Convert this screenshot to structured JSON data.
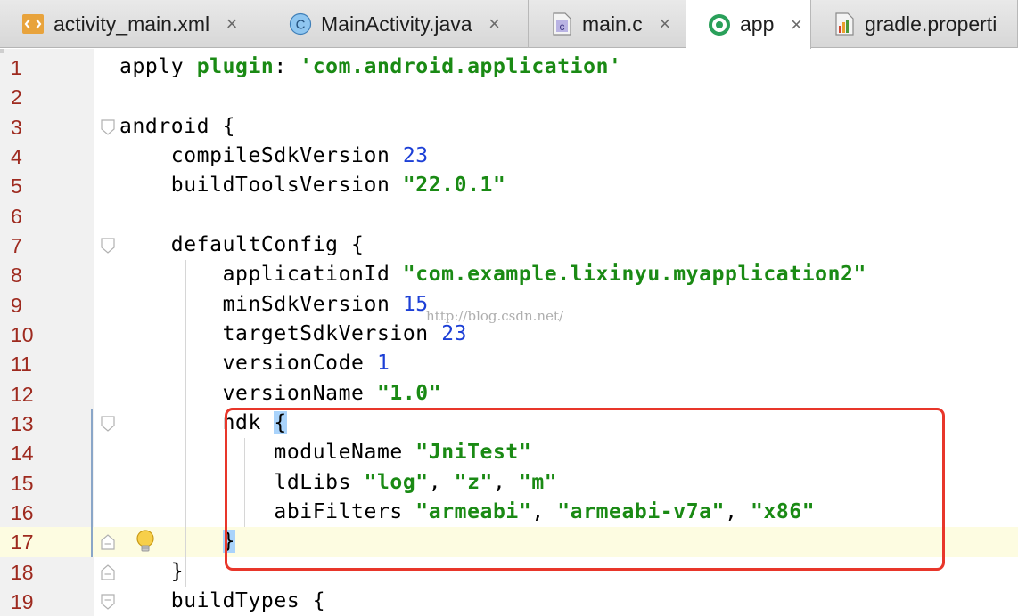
{
  "tabs": [
    {
      "label": "activity_main.xml",
      "icon": "xml-layout-icon",
      "active": false
    },
    {
      "label": "MainActivity.java",
      "icon": "java-class-icon",
      "active": false
    },
    {
      "label": "main.c",
      "icon": "c-file-icon",
      "active": false
    },
    {
      "label": "app",
      "icon": "gradle-module-icon",
      "active": true
    },
    {
      "label": "gradle.properti",
      "icon": "properties-file-icon",
      "active": false
    }
  ],
  "close_glyph": "×",
  "editor": {
    "current_line": 17,
    "lines": [
      {
        "n": "1",
        "tokens": [
          [
            "",
            "apply "
          ],
          [
            "kw",
            "plugin"
          ],
          [
            "",
            ": "
          ],
          [
            "str",
            "'com.android.application'"
          ]
        ]
      },
      {
        "n": "2",
        "tokens": []
      },
      {
        "n": "3",
        "tokens": [
          [
            "",
            "android {"
          ]
        ]
      },
      {
        "n": "4",
        "tokens": [
          [
            "",
            "    compileSdkVersion "
          ],
          [
            "num",
            "23"
          ]
        ]
      },
      {
        "n": "5",
        "tokens": [
          [
            "",
            "    buildToolsVersion "
          ],
          [
            "str",
            "\"22.0.1\""
          ]
        ]
      },
      {
        "n": "6",
        "tokens": []
      },
      {
        "n": "7",
        "tokens": [
          [
            "",
            "    defaultConfig {"
          ]
        ]
      },
      {
        "n": "8",
        "tokens": [
          [
            "",
            "        applicationId "
          ],
          [
            "str",
            "\"com.example.lixinyu.myapplication2\""
          ]
        ]
      },
      {
        "n": "9",
        "tokens": [
          [
            "",
            "        minSdkVersion "
          ],
          [
            "num",
            "15"
          ]
        ]
      },
      {
        "n": "10",
        "tokens": [
          [
            "",
            "        targetSdkVersion "
          ],
          [
            "num",
            "23"
          ]
        ]
      },
      {
        "n": "11",
        "tokens": [
          [
            "",
            "        versionCode "
          ],
          [
            "num",
            "1"
          ]
        ]
      },
      {
        "n": "12",
        "tokens": [
          [
            "",
            "        versionName "
          ],
          [
            "str",
            "\"1.0\""
          ]
        ]
      },
      {
        "n": "13",
        "tokens": [
          [
            "",
            "        ndk "
          ],
          [
            "brace",
            "{"
          ]
        ]
      },
      {
        "n": "14",
        "tokens": [
          [
            "",
            "            moduleName "
          ],
          [
            "str",
            "\"JniTest\""
          ]
        ]
      },
      {
        "n": "15",
        "tokens": [
          [
            "",
            "            ldLibs "
          ],
          [
            "str",
            "\"log\""
          ],
          [
            "",
            ", "
          ],
          [
            "str",
            "\"z\""
          ],
          [
            "",
            ", "
          ],
          [
            "str",
            "\"m\""
          ]
        ]
      },
      {
        "n": "16",
        "tokens": [
          [
            "",
            "            abiFilters "
          ],
          [
            "str",
            "\"armeabi\""
          ],
          [
            "",
            ", "
          ],
          [
            "str",
            "\"armeabi-v7a\""
          ],
          [
            "",
            ", "
          ],
          [
            "str",
            "\"x86\""
          ]
        ]
      },
      {
        "n": "17",
        "tokens": [
          [
            "",
            "        "
          ],
          [
            "brace",
            "}"
          ]
        ]
      },
      {
        "n": "18",
        "tokens": [
          [
            "",
            "    }"
          ]
        ]
      },
      {
        "n": "19",
        "tokens": [
          [
            "",
            "    buildTypes {"
          ]
        ]
      }
    ],
    "fold_start_lines": [
      3,
      7,
      13
    ],
    "fold_end_lines": [
      17,
      18
    ],
    "fold_lines": [
      19
    ],
    "bulb_line": 17,
    "bulb_icon": "lightbulb-intention-icon",
    "highlight_lines": [
      13,
      17
    ],
    "watermark": "http://blog.csdn.net/"
  },
  "colors": {
    "keyword": "#1a8a14",
    "string": "#1a8a14",
    "number": "#1c3fd6",
    "line_number": "#9e2a1f",
    "highlight_box": "#e8362a",
    "current_line": "#fdfce1",
    "brace_match": "#a9d3fb"
  }
}
